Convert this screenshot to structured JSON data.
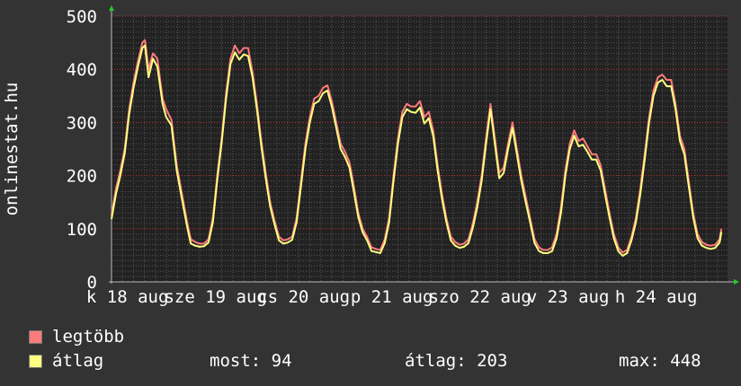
{
  "chart_data": {
    "type": "line",
    "ylabel": "onlinestat.hu",
    "ylim": [
      0,
      500
    ],
    "y_ticks": [
      "0",
      "100",
      "200",
      "300",
      "400",
      "500"
    ],
    "x_tick_labels": [
      "k 18 aug",
      "sze 19 aug",
      "cs 20 aug",
      "p 21 aug",
      "szo 22 aug",
      "v 23 aug",
      "h 24 aug"
    ],
    "x_tick_positions_days": [
      0.18,
      1.18,
      2.18,
      3.18,
      4.18,
      5.18,
      6.18
    ],
    "x_day_range": [
      0,
      7
    ],
    "grid": true,
    "series": [
      {
        "name": "legtöbb",
        "color": "#ff7a7a",
        "points": [
          [
            0.0,
            125
          ],
          [
            0.05,
            175
          ],
          [
            0.1,
            210
          ],
          [
            0.15,
            250
          ],
          [
            0.2,
            325
          ],
          [
            0.25,
            375
          ],
          [
            0.3,
            415
          ],
          [
            0.35,
            450
          ],
          [
            0.38,
            455
          ],
          [
            0.42,
            400
          ],
          [
            0.47,
            430
          ],
          [
            0.52,
            420
          ],
          [
            0.58,
            345
          ],
          [
            0.62,
            325
          ],
          [
            0.68,
            305
          ],
          [
            0.74,
            220
          ],
          [
            0.8,
            165
          ],
          [
            0.86,
            110
          ],
          [
            0.9,
            80
          ],
          [
            0.95,
            75
          ],
          [
            1.0,
            72
          ],
          [
            1.05,
            72
          ],
          [
            1.1,
            80
          ],
          [
            1.15,
            120
          ],
          [
            1.2,
            200
          ],
          [
            1.25,
            270
          ],
          [
            1.3,
            355
          ],
          [
            1.35,
            420
          ],
          [
            1.4,
            445
          ],
          [
            1.45,
            430
          ],
          [
            1.5,
            440
          ],
          [
            1.55,
            440
          ],
          [
            1.6,
            395
          ],
          [
            1.65,
            335
          ],
          [
            1.7,
            265
          ],
          [
            1.75,
            205
          ],
          [
            1.8,
            150
          ],
          [
            1.85,
            115
          ],
          [
            1.9,
            85
          ],
          [
            1.95,
            78
          ],
          [
            2.0,
            80
          ],
          [
            2.05,
            85
          ],
          [
            2.1,
            120
          ],
          [
            2.15,
            190
          ],
          [
            2.2,
            260
          ],
          [
            2.25,
            310
          ],
          [
            2.3,
            345
          ],
          [
            2.35,
            350
          ],
          [
            2.4,
            365
          ],
          [
            2.45,
            370
          ],
          [
            2.5,
            340
          ],
          [
            2.55,
            300
          ],
          [
            2.6,
            260
          ],
          [
            2.65,
            245
          ],
          [
            2.7,
            225
          ],
          [
            2.75,
            180
          ],
          [
            2.8,
            130
          ],
          [
            2.85,
            100
          ],
          [
            2.9,
            85
          ],
          [
            2.95,
            65
          ],
          [
            3.0,
            62
          ],
          [
            3.05,
            60
          ],
          [
            3.1,
            80
          ],
          [
            3.15,
            120
          ],
          [
            3.2,
            200
          ],
          [
            3.25,
            270
          ],
          [
            3.3,
            320
          ],
          [
            3.35,
            335
          ],
          [
            3.4,
            330
          ],
          [
            3.45,
            330
          ],
          [
            3.5,
            340
          ],
          [
            3.55,
            310
          ],
          [
            3.6,
            320
          ],
          [
            3.65,
            285
          ],
          [
            3.7,
            220
          ],
          [
            3.75,
            165
          ],
          [
            3.8,
            120
          ],
          [
            3.85,
            85
          ],
          [
            3.9,
            75
          ],
          [
            3.95,
            70
          ],
          [
            4.0,
            72
          ],
          [
            4.05,
            80
          ],
          [
            4.1,
            110
          ],
          [
            4.15,
            150
          ],
          [
            4.2,
            200
          ],
          [
            4.25,
            270
          ],
          [
            4.3,
            335
          ],
          [
            4.35,
            270
          ],
          [
            4.4,
            205
          ],
          [
            4.45,
            215
          ],
          [
            4.5,
            260
          ],
          [
            4.55,
            300
          ],
          [
            4.6,
            250
          ],
          [
            4.65,
            200
          ],
          [
            4.7,
            160
          ],
          [
            4.75,
            120
          ],
          [
            4.8,
            80
          ],
          [
            4.85,
            65
          ],
          [
            4.9,
            60
          ],
          [
            4.95,
            60
          ],
          [
            5.0,
            65
          ],
          [
            5.05,
            90
          ],
          [
            5.1,
            140
          ],
          [
            5.15,
            210
          ],
          [
            5.2,
            260
          ],
          [
            5.25,
            285
          ],
          [
            5.3,
            265
          ],
          [
            5.35,
            270
          ],
          [
            5.4,
            255
          ],
          [
            5.45,
            240
          ],
          [
            5.5,
            240
          ],
          [
            5.55,
            220
          ],
          [
            5.6,
            175
          ],
          [
            5.65,
            130
          ],
          [
            5.7,
            90
          ],
          [
            5.75,
            65
          ],
          [
            5.8,
            55
          ],
          [
            5.85,
            60
          ],
          [
            5.9,
            85
          ],
          [
            5.95,
            120
          ],
          [
            6.0,
            175
          ],
          [
            6.05,
            240
          ],
          [
            6.1,
            310
          ],
          [
            6.15,
            360
          ],
          [
            6.2,
            385
          ],
          [
            6.25,
            390
          ],
          [
            6.3,
            380
          ],
          [
            6.35,
            380
          ],
          [
            6.4,
            335
          ],
          [
            6.45,
            275
          ],
          [
            6.5,
            250
          ],
          [
            6.55,
            190
          ],
          [
            6.6,
            130
          ],
          [
            6.65,
            90
          ],
          [
            6.7,
            75
          ],
          [
            6.75,
            70
          ],
          [
            6.8,
            68
          ],
          [
            6.85,
            70
          ],
          [
            6.9,
            80
          ],
          [
            6.92,
            100
          ]
        ]
      },
      {
        "name": "átlag",
        "color": "#ffff80",
        "points": [
          [
            0.0,
            118
          ],
          [
            0.05,
            165
          ],
          [
            0.1,
            200
          ],
          [
            0.15,
            242
          ],
          [
            0.2,
            315
          ],
          [
            0.25,
            365
          ],
          [
            0.3,
            405
          ],
          [
            0.35,
            440
          ],
          [
            0.38,
            445
          ],
          [
            0.42,
            385
          ],
          [
            0.47,
            420
          ],
          [
            0.52,
            405
          ],
          [
            0.58,
            335
          ],
          [
            0.62,
            310
          ],
          [
            0.68,
            295
          ],
          [
            0.74,
            210
          ],
          [
            0.8,
            155
          ],
          [
            0.86,
            102
          ],
          [
            0.9,
            72
          ],
          [
            0.95,
            68
          ],
          [
            1.0,
            66
          ],
          [
            1.05,
            67
          ],
          [
            1.1,
            74
          ],
          [
            1.15,
            112
          ],
          [
            1.2,
            192
          ],
          [
            1.25,
            262
          ],
          [
            1.3,
            345
          ],
          [
            1.35,
            410
          ],
          [
            1.4,
            432
          ],
          [
            1.45,
            418
          ],
          [
            1.5,
            428
          ],
          [
            1.55,
            425
          ],
          [
            1.6,
            385
          ],
          [
            1.65,
            325
          ],
          [
            1.7,
            255
          ],
          [
            1.75,
            195
          ],
          [
            1.8,
            142
          ],
          [
            1.85,
            108
          ],
          [
            1.9,
            78
          ],
          [
            1.95,
            72
          ],
          [
            2.0,
            74
          ],
          [
            2.05,
            79
          ],
          [
            2.1,
            112
          ],
          [
            2.15,
            180
          ],
          [
            2.2,
            250
          ],
          [
            2.25,
            300
          ],
          [
            2.3,
            335
          ],
          [
            2.35,
            340
          ],
          [
            2.4,
            355
          ],
          [
            2.45,
            360
          ],
          [
            2.5,
            330
          ],
          [
            2.55,
            290
          ],
          [
            2.6,
            250
          ],
          [
            2.65,
            235
          ],
          [
            2.7,
            215
          ],
          [
            2.75,
            170
          ],
          [
            2.8,
            122
          ],
          [
            2.85,
            93
          ],
          [
            2.9,
            78
          ],
          [
            2.95,
            58
          ],
          [
            3.0,
            56
          ],
          [
            3.05,
            54
          ],
          [
            3.1,
            73
          ],
          [
            3.15,
            112
          ],
          [
            3.2,
            190
          ],
          [
            3.25,
            260
          ],
          [
            3.3,
            310
          ],
          [
            3.35,
            325
          ],
          [
            3.4,
            320
          ],
          [
            3.45,
            318
          ],
          [
            3.5,
            328
          ],
          [
            3.55,
            298
          ],
          [
            3.6,
            308
          ],
          [
            3.65,
            275
          ],
          [
            3.7,
            210
          ],
          [
            3.75,
            156
          ],
          [
            3.8,
            112
          ],
          [
            3.85,
            78
          ],
          [
            3.9,
            68
          ],
          [
            3.95,
            64
          ],
          [
            4.0,
            66
          ],
          [
            4.05,
            73
          ],
          [
            4.1,
            102
          ],
          [
            4.15,
            140
          ],
          [
            4.2,
            190
          ],
          [
            4.25,
            260
          ],
          [
            4.3,
            325
          ],
          [
            4.35,
            260
          ],
          [
            4.4,
            195
          ],
          [
            4.45,
            205
          ],
          [
            4.5,
            250
          ],
          [
            4.55,
            290
          ],
          [
            4.6,
            240
          ],
          [
            4.65,
            190
          ],
          [
            4.7,
            150
          ],
          [
            4.75,
            112
          ],
          [
            4.8,
            73
          ],
          [
            4.85,
            58
          ],
          [
            4.9,
            54
          ],
          [
            4.95,
            54
          ],
          [
            5.0,
            58
          ],
          [
            5.05,
            82
          ],
          [
            5.1,
            130
          ],
          [
            5.15,
            200
          ],
          [
            5.2,
            250
          ],
          [
            5.25,
            275
          ],
          [
            5.3,
            255
          ],
          [
            5.35,
            258
          ],
          [
            5.4,
            245
          ],
          [
            5.45,
            230
          ],
          [
            5.5,
            230
          ],
          [
            5.55,
            210
          ],
          [
            5.6,
            165
          ],
          [
            5.65,
            122
          ],
          [
            5.7,
            82
          ],
          [
            5.75,
            58
          ],
          [
            5.8,
            49
          ],
          [
            5.85,
            54
          ],
          [
            5.9,
            78
          ],
          [
            5.95,
            112
          ],
          [
            6.0,
            165
          ],
          [
            6.05,
            230
          ],
          [
            6.1,
            300
          ],
          [
            6.15,
            350
          ],
          [
            6.2,
            375
          ],
          [
            6.25,
            380
          ],
          [
            6.3,
            368
          ],
          [
            6.35,
            368
          ],
          [
            6.4,
            325
          ],
          [
            6.45,
            265
          ],
          [
            6.5,
            240
          ],
          [
            6.55,
            180
          ],
          [
            6.6,
            122
          ],
          [
            6.65,
            82
          ],
          [
            6.7,
            68
          ],
          [
            6.75,
            64
          ],
          [
            6.8,
            62
          ],
          [
            6.85,
            64
          ],
          [
            6.9,
            74
          ],
          [
            6.92,
            94
          ]
        ]
      }
    ]
  },
  "legend": {
    "items": [
      {
        "label": "legtöbb",
        "color": "#ff7a7a"
      },
      {
        "label": "átlag",
        "color": "#ffff80"
      }
    ]
  },
  "stats": {
    "most": "most: 94",
    "atlag": "átlag: 203",
    "max": "max: 448"
  },
  "colors": {
    "background": "#333333",
    "plot_background": "#222222",
    "grid_major": "#cc3333",
    "grid_minor": "#555555",
    "axis": "#bbbbbb",
    "arrow": "#22cc22"
  }
}
